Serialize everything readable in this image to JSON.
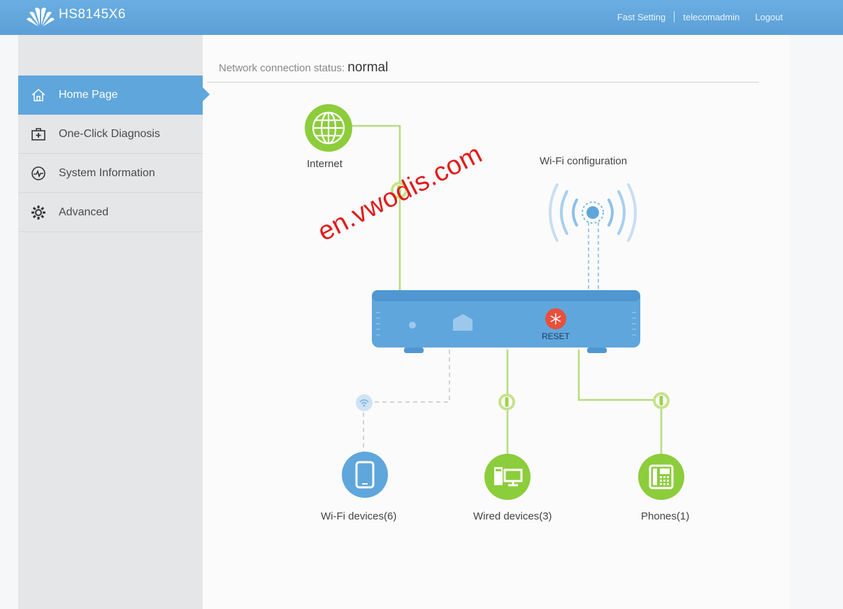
{
  "header": {
    "model": "HS8145X6",
    "links": [
      "Fast Setting",
      "telecomadmin",
      "Logout"
    ]
  },
  "nav": [
    {
      "label": "Home Page",
      "icon": "home-icon",
      "active": true
    },
    {
      "label": "One-Click Diagnosis",
      "icon": "first-aid-icon",
      "active": false
    },
    {
      "label": "System Information",
      "icon": "pulse-icon",
      "active": false
    },
    {
      "label": "Advanced",
      "icon": "gear-icon",
      "active": false
    }
  ],
  "status": {
    "label": "Network connection status:",
    "value": "normal"
  },
  "diagram": {
    "internet": "Internet",
    "wifi_config": "Wi-Fi configuration",
    "reset": "RESET",
    "wifi_devices": "Wi-Fi devices(6)",
    "wired_devices": "Wired devices(3)",
    "phones": "Phones(1)"
  },
  "watermark": "en.vwodis.com",
  "colors": {
    "accent_blue": "#5fa6dc",
    "green": "#8ccd3c",
    "line_green": "#b7dc7c",
    "reset_red": "#e8503c"
  }
}
